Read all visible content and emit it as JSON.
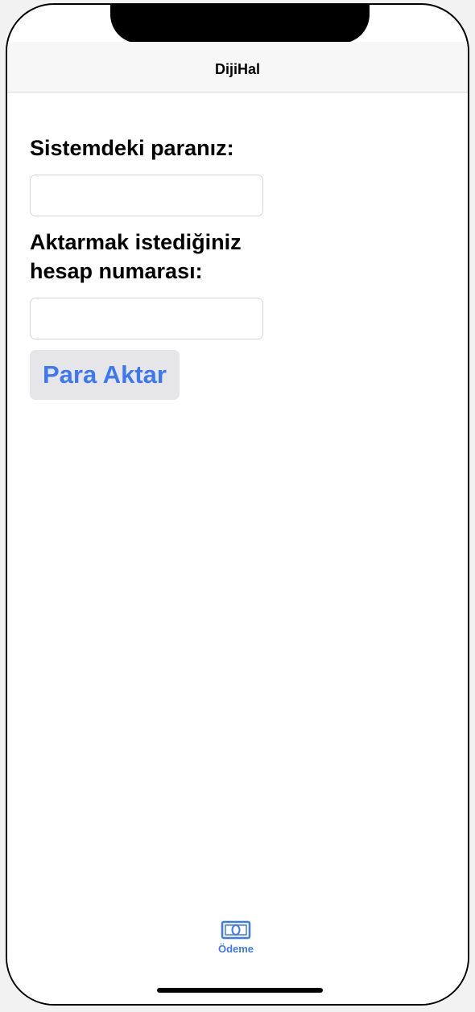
{
  "navbar": {
    "title": "DijiHal"
  },
  "form": {
    "balance_label": "Sistemdeki paranız:",
    "balance_value": "",
    "account_label": "Aktarmak istediğiniz hesap numarası:",
    "account_value": "",
    "submit_label": "Para Aktar"
  },
  "tabbar": {
    "items": [
      {
        "label": "Ödeme",
        "icon": "banknote-icon",
        "active": true
      }
    ]
  },
  "colors": {
    "accent": "#3e78f1",
    "button_bg": "#e6e6e9",
    "navbar_bg": "#f7f7f7"
  }
}
